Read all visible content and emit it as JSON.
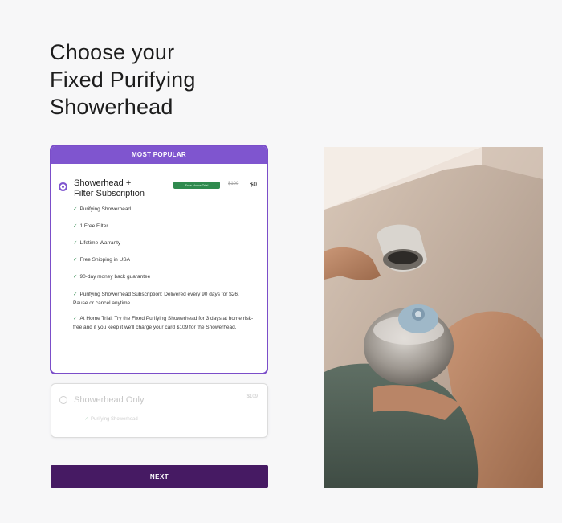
{
  "page": {
    "title_lines": [
      "Choose your",
      "Fixed Purifying",
      "Showerhead"
    ]
  },
  "plans": {
    "popular": {
      "banner": "MOST POPULAR",
      "name_line1": "Showerhead +",
      "name_line2": "Filter Subscription",
      "badge": "Free Home Trial",
      "old_price": "$109",
      "price": "$0",
      "selected": true,
      "features": [
        "Purifying Showerhead",
        "1 Free Filter",
        "Lifetime Warranty",
        "Free Shipping in USA",
        "90-day money back guarantee",
        "Purifying Showerhead Subscription: Delivered every 90 days for $26. Pause or cancel anytime",
        "At Home Trial: Try the Fixed Purifying Showerhead for 3 days at home risk-free and if you keep it we'll charge your card $109 for the Showerhead."
      ]
    },
    "only": {
      "name": "Showerhead Only",
      "price": "$109",
      "selected": false,
      "feature": "Purifying Showerhead"
    }
  },
  "actions": {
    "next_label": "NEXT"
  },
  "icons": {
    "check": "check-icon",
    "radio": "radio-icon"
  },
  "colors": {
    "accent": "#7f55cf",
    "button": "#461a63",
    "badge": "#2f8a4e",
    "check": "#4f9a68"
  }
}
